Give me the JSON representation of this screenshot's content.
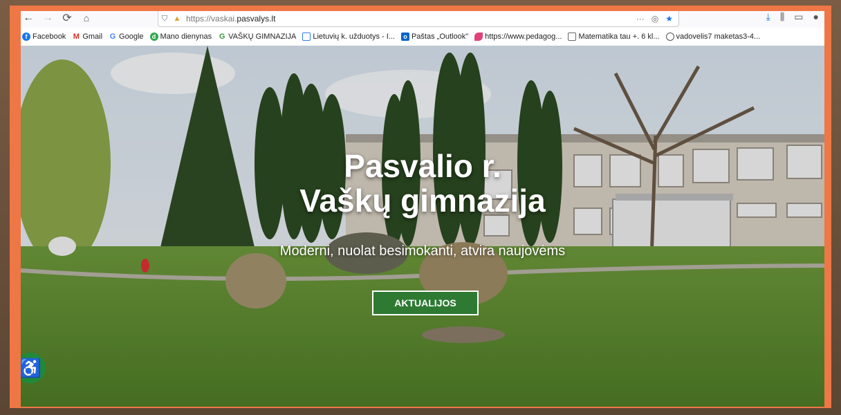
{
  "browser": {
    "url_prefix": "https://",
    "url_host_gray": "vaskai.",
    "url_host": "pasvalys.lt",
    "icons": {
      "back": "back-arrow-icon",
      "forward": "forward-arrow-icon",
      "reload": "reload-icon",
      "home": "home-icon",
      "shield": "shield-icon",
      "lock": "lock-icon",
      "more": "more-icon",
      "pocket": "pocket-icon",
      "bookmark_star": "star-icon",
      "download": "download-icon",
      "library": "library-icon",
      "sidebar": "sidebar-icon",
      "account": "account-icon"
    },
    "more_glyph": "···"
  },
  "bookmarks": [
    {
      "label": "Facebook",
      "icon": "facebook-icon",
      "glyph": "f",
      "color": "#1877f2"
    },
    {
      "label": "Gmail",
      "icon": "gmail-icon",
      "glyph": "M",
      "color": "#ffffff"
    },
    {
      "label": "Google",
      "icon": "google-icon",
      "glyph": "G",
      "color": "#ffffff"
    },
    {
      "label": "Mano dienynas",
      "icon": "dienynas-icon",
      "glyph": "d",
      "color": "#2fa84f"
    },
    {
      "label": "VAŠKŲ GIMNAZIJA",
      "icon": "school-icon",
      "glyph": "G",
      "color": "#ffffff"
    },
    {
      "label": "Lietuvių k. užduotys - I...",
      "icon": "page-icon",
      "glyph": "",
      "color": "#2c7be5"
    },
    {
      "label": "Paštas „Outlook\"",
      "icon": "outlook-icon",
      "glyph": "o",
      "color": "#0a64c8"
    },
    {
      "label": "https://www.pedagog...",
      "icon": "pedagogas-icon",
      "glyph": "",
      "color": "#e0427a"
    },
    {
      "label": "Matematika tau +. 6 kl...",
      "icon": "book-icon",
      "glyph": "",
      "color": "#666666"
    },
    {
      "label": "vadovelis7 maketas3-4...",
      "icon": "globe-icon",
      "glyph": "",
      "color": "#555555"
    }
  ],
  "hero": {
    "title_line1": "Pasvalio r.",
    "title_line2": "Vaškų gimnazija",
    "subtitle": "Moderni, nuolat besimokanti, atvira naujovėms",
    "cta_label": "AKTUALIJOS"
  },
  "accessibility": {
    "icon": "wheelchair-icon",
    "glyph": "♿"
  },
  "colors": {
    "frame": "#ee7745",
    "cta": "#2e7a33",
    "a11y": "#1f8a3a"
  }
}
